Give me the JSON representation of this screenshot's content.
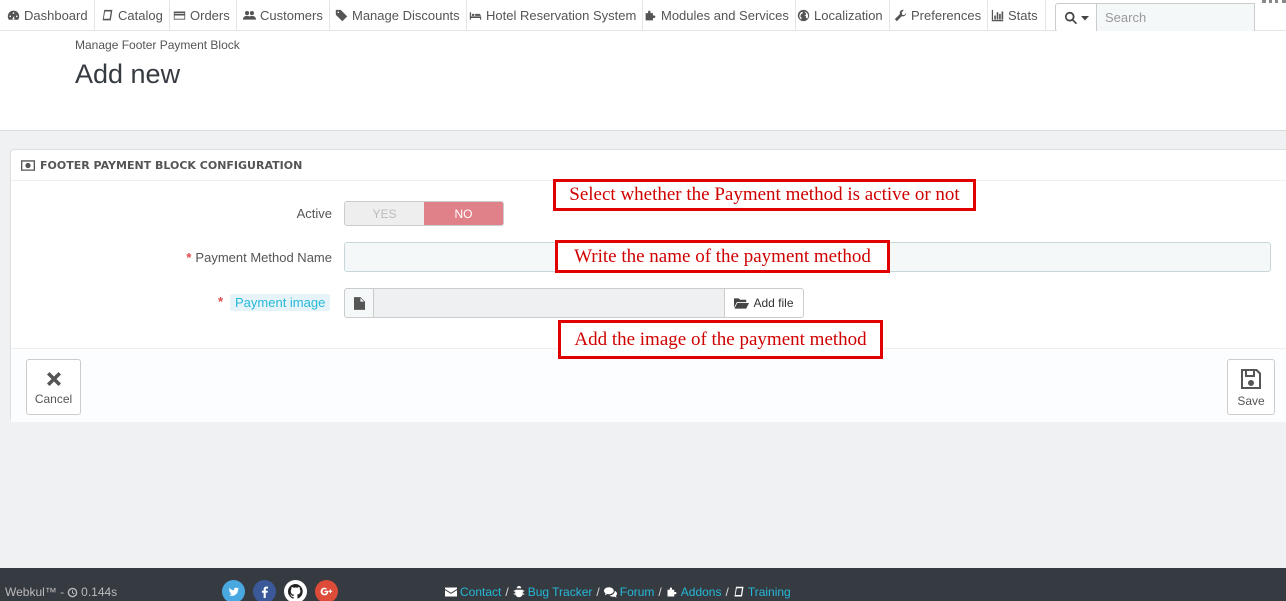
{
  "nav": {
    "items": [
      {
        "label": "Dashboard",
        "icon": "dashboard-icon"
      },
      {
        "label": "Catalog",
        "icon": "book-icon"
      },
      {
        "label": "Orders",
        "icon": "credit-card-icon"
      },
      {
        "label": "Customers",
        "icon": "users-icon"
      },
      {
        "label": "Manage Discounts",
        "icon": "tags-icon"
      },
      {
        "label": "Hotel Reservation System",
        "icon": "bed-icon"
      },
      {
        "label": "Modules and Services",
        "icon": "puzzle-icon"
      },
      {
        "label": "Localization",
        "icon": "globe-icon"
      },
      {
        "label": "Preferences",
        "icon": "wrench-icon"
      },
      {
        "label": "Stats",
        "icon": "bar-chart-icon"
      }
    ],
    "search_placeholder": "Search"
  },
  "header": {
    "breadcrumb": "Manage Footer Payment Block",
    "title": "Add new"
  },
  "panel": {
    "heading": "FOOTER PAYMENT BLOCK CONFIGURATION",
    "active_label": "Active",
    "switch_yes": "YES",
    "switch_no": "NO",
    "switch_value": "NO",
    "name_label": "Payment Method Name",
    "name_value": "",
    "image_label": "Payment image",
    "add_file_label": "Add file",
    "required_mark": "*",
    "cancel_label": "Cancel",
    "save_label": "Save"
  },
  "annotations": {
    "active_note": "Select whether the Payment method is active or not",
    "name_note": "Write the name of the payment method",
    "image_note": "Add the image of the payment method"
  },
  "footer": {
    "brand": "Webkul™ -",
    "load_time": "0.144s",
    "links": [
      {
        "label": "Contact",
        "icon": "envelope-icon"
      },
      {
        "label": "Bug Tracker",
        "icon": "bug-icon"
      },
      {
        "label": "Forum",
        "icon": "comments-icon"
      },
      {
        "label": "Addons",
        "icon": "puzzle-icon"
      },
      {
        "label": "Training",
        "icon": "book-icon"
      }
    ],
    "separator": "/"
  },
  "colors": {
    "accent": "#25b9d7",
    "switch_no": "#e08088",
    "annotation": "#e00000",
    "footer_bg": "#363a41"
  }
}
